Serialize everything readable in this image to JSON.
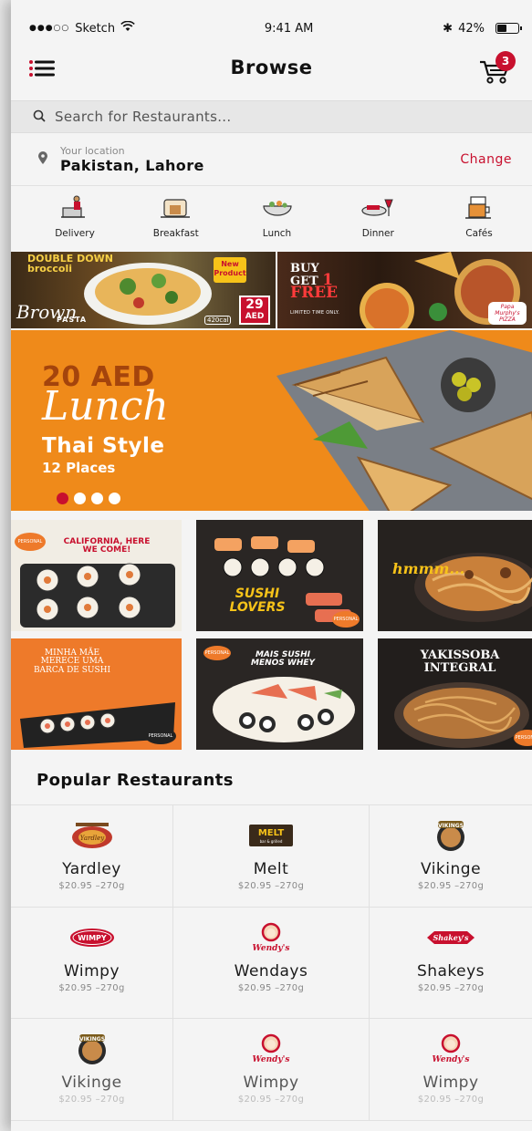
{
  "status_bar": {
    "carrier": "Sketch",
    "time": "9:41 AM",
    "battery": "42%"
  },
  "nav": {
    "title": "Browse",
    "cart_count": "3"
  },
  "search": {
    "placeholder": "Search for Restaurants..."
  },
  "location": {
    "caption": "Your location",
    "city": "Pakistan, Lahore",
    "change_label": "Change"
  },
  "categories": [
    {
      "label": "Delivery",
      "icon": "delivery-icon"
    },
    {
      "label": "Breakfast",
      "icon": "breakfast-icon"
    },
    {
      "label": "Lunch",
      "icon": "lunch-icon"
    },
    {
      "label": "Dinner",
      "icon": "dinner-icon"
    },
    {
      "label": "Cafés",
      "icon": "cafe-icon"
    }
  ],
  "promos": {
    "left": {
      "brand_top": "DOUBLE DOWN broccoli",
      "tag": "New Product",
      "brand": "Brown",
      "sub": "PASTA",
      "price": "29",
      "currency": "AED",
      "size": "420cal"
    },
    "right": {
      "line1": "BUY",
      "line2": "GET",
      "big": "1",
      "line3": "FREE",
      "fine": "LIMITED TIME ONLY.",
      "brand": "Papa Murphy's PIZZA"
    }
  },
  "hero": {
    "price": "20 AED",
    "title": "Lunch",
    "style": "Thai Style",
    "places": "12 Places",
    "pages": 4,
    "active_page": 1
  },
  "tiles": [
    {
      "title": "CALIFORNIA, HERE WE COME!",
      "badge": "PERSONAL"
    },
    {
      "title": "SUSHI LOVERS",
      "badge": "PERSONAL"
    },
    {
      "title": "hmmm...",
      "badge": "PERSONAL"
    },
    {
      "title": "MINHA MÃE MERECE UMA BARCA DE SUSHI",
      "badge": "PERSONAL"
    },
    {
      "title": "MAIS SUSHI MENOS WHEY",
      "badge": "PERSONAL"
    },
    {
      "title": "YAKISSOBA INTEGRAL",
      "badge": "PERSONAL"
    }
  ],
  "popular": {
    "heading": "Popular Restaurants",
    "restaurants": [
      {
        "name": "Yardley",
        "meta": "$20.95 –270g",
        "logo": "Yardley"
      },
      {
        "name": "Melt",
        "meta": "$20.95 –270g",
        "logo": "MELT"
      },
      {
        "name": "Vikinge",
        "meta": "$20.95 –270g",
        "logo": "VIKINGS"
      },
      {
        "name": "Wimpy",
        "meta": "$20.95 –270g",
        "logo": "WIMPY"
      },
      {
        "name": "Wendays",
        "meta": "$20.95 –270g",
        "logo": "Wendy's"
      },
      {
        "name": "Shakeys",
        "meta": "$20.95 –270g",
        "logo": "Shakey's"
      },
      {
        "name": "Vikinge",
        "meta": "$20.95 –270g",
        "logo": "VIKINGS"
      },
      {
        "name": "Wimpy",
        "meta": "$20.95 –270g",
        "logo": "Wendy's"
      },
      {
        "name": "Wimpy",
        "meta": "$20.95 –270g",
        "logo": "Wendy's"
      }
    ]
  },
  "colors": {
    "accent": "#c8102e",
    "hero_orange": "#ef8a1a"
  }
}
